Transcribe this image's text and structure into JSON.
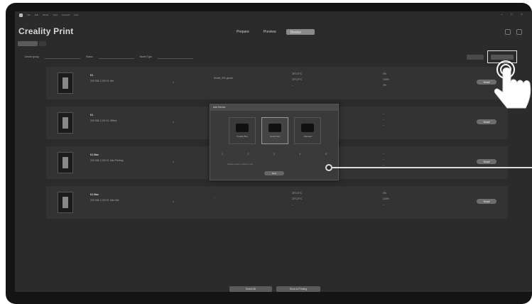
{
  "app": {
    "menu": [
      "File",
      "Edit",
      "Model",
      "Tools",
      "Network",
      "Help"
    ],
    "title": "Creality Print",
    "window_controls": [
      "–",
      "□",
      "×"
    ]
  },
  "nav": {
    "tabs": [
      "Prepare",
      "Preview",
      "Device"
    ],
    "active": "Device"
  },
  "device_tabs": [
    "LAN Printer",
    "All"
  ],
  "filter": {
    "group_label": "Device group",
    "group_value": "Printer",
    "status_label": "Status",
    "status_value": "All",
    "model_label": "Model Type",
    "model_value": "All",
    "btn_refresh": "Refresh",
    "btn_add": "Add Device"
  },
  "rows": [
    {
      "name": "K1",
      "ip": "192.168.1.100",
      "model": "K1",
      "status": "Idle",
      "count": "1",
      "file": "Model_001.gcode",
      "nozzle": "26°C/0°C",
      "bed": "25°C/0°C",
      "chamber": "--",
      "fan": "0%",
      "speed": "100%",
      "progress": "0%",
      "action": "Detail"
    },
    {
      "name": "K1",
      "ip": "192.168.1.101",
      "model": "K1",
      "status": "Offline",
      "count": "1",
      "file": "--",
      "nozzle": "--",
      "bed": "--",
      "chamber": "--",
      "fan": "--",
      "speed": "--",
      "progress": "--",
      "action": "Detail"
    },
    {
      "name": "K1 Max",
      "ip": "192.168.1.102",
      "model": "K1 Max",
      "status": "Printing",
      "count": "1",
      "file": "--",
      "nozzle": "--",
      "bed": "--",
      "chamber": "--",
      "fan": "--",
      "speed": "--",
      "progress": "--",
      "action": "Detail"
    },
    {
      "name": "K1 Max",
      "ip": "192.168.1.103",
      "model": "K1 Max",
      "status": "Idle",
      "count": "1",
      "file": "--",
      "nozzle": "25°C/0°C",
      "bed": "25°C/0°C",
      "chamber": "--",
      "fan": "0%",
      "speed": "100%",
      "progress": "--",
      "action": "Detail"
    }
  ],
  "dialog": {
    "title": "Add Device",
    "options": [
      "Creality Box",
      "Sonic Pad",
      "Mainsail"
    ],
    "steps": [
      "1",
      "2",
      "3",
      "4",
      "5"
    ],
    "note": "Please select a device type",
    "ok": "Next"
  },
  "bottom": {
    "btn_1": "Select All",
    "btn_2": "Send to Printing"
  }
}
